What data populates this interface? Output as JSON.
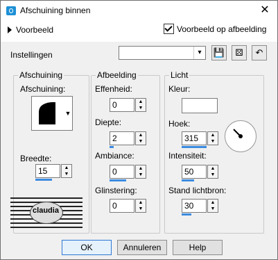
{
  "window": {
    "title": "Afschuining binnen"
  },
  "preview": {
    "toggle_label": "Voorbeeld",
    "checkbox_label": "Voorbeeld op afbeelding",
    "checked": true
  },
  "settings": {
    "label": "Instellingen",
    "preset_value": ""
  },
  "groups": {
    "afschuining": {
      "title": "Afschuining",
      "shape_label": "Afschuining:",
      "width_label": "Breedte:",
      "width_value": "15"
    },
    "afbeelding": {
      "title": "Afbeelding",
      "effenheid_label": "Effenheid:",
      "effenheid_value": "0",
      "diepte_label": "Diepte:",
      "diepte_value": "2",
      "ambiance_label": "Ambiance:",
      "ambiance_value": "0",
      "glinstering_label": "Glinstering:",
      "glinstering_value": "0"
    },
    "licht": {
      "title": "Licht",
      "kleur_label": "Kleur:",
      "kleur_value": "#ffffff",
      "hoek_label": "Hoek:",
      "hoek_value": "315",
      "intensiteit_label": "Intensiteit:",
      "intensiteit_value": "50",
      "stand_label": "Stand lichtbron:",
      "stand_value": "30"
    }
  },
  "watermark": {
    "text": "claudia"
  },
  "buttons": {
    "ok": "OK",
    "cancel": "Annuleren",
    "help": "Help"
  }
}
